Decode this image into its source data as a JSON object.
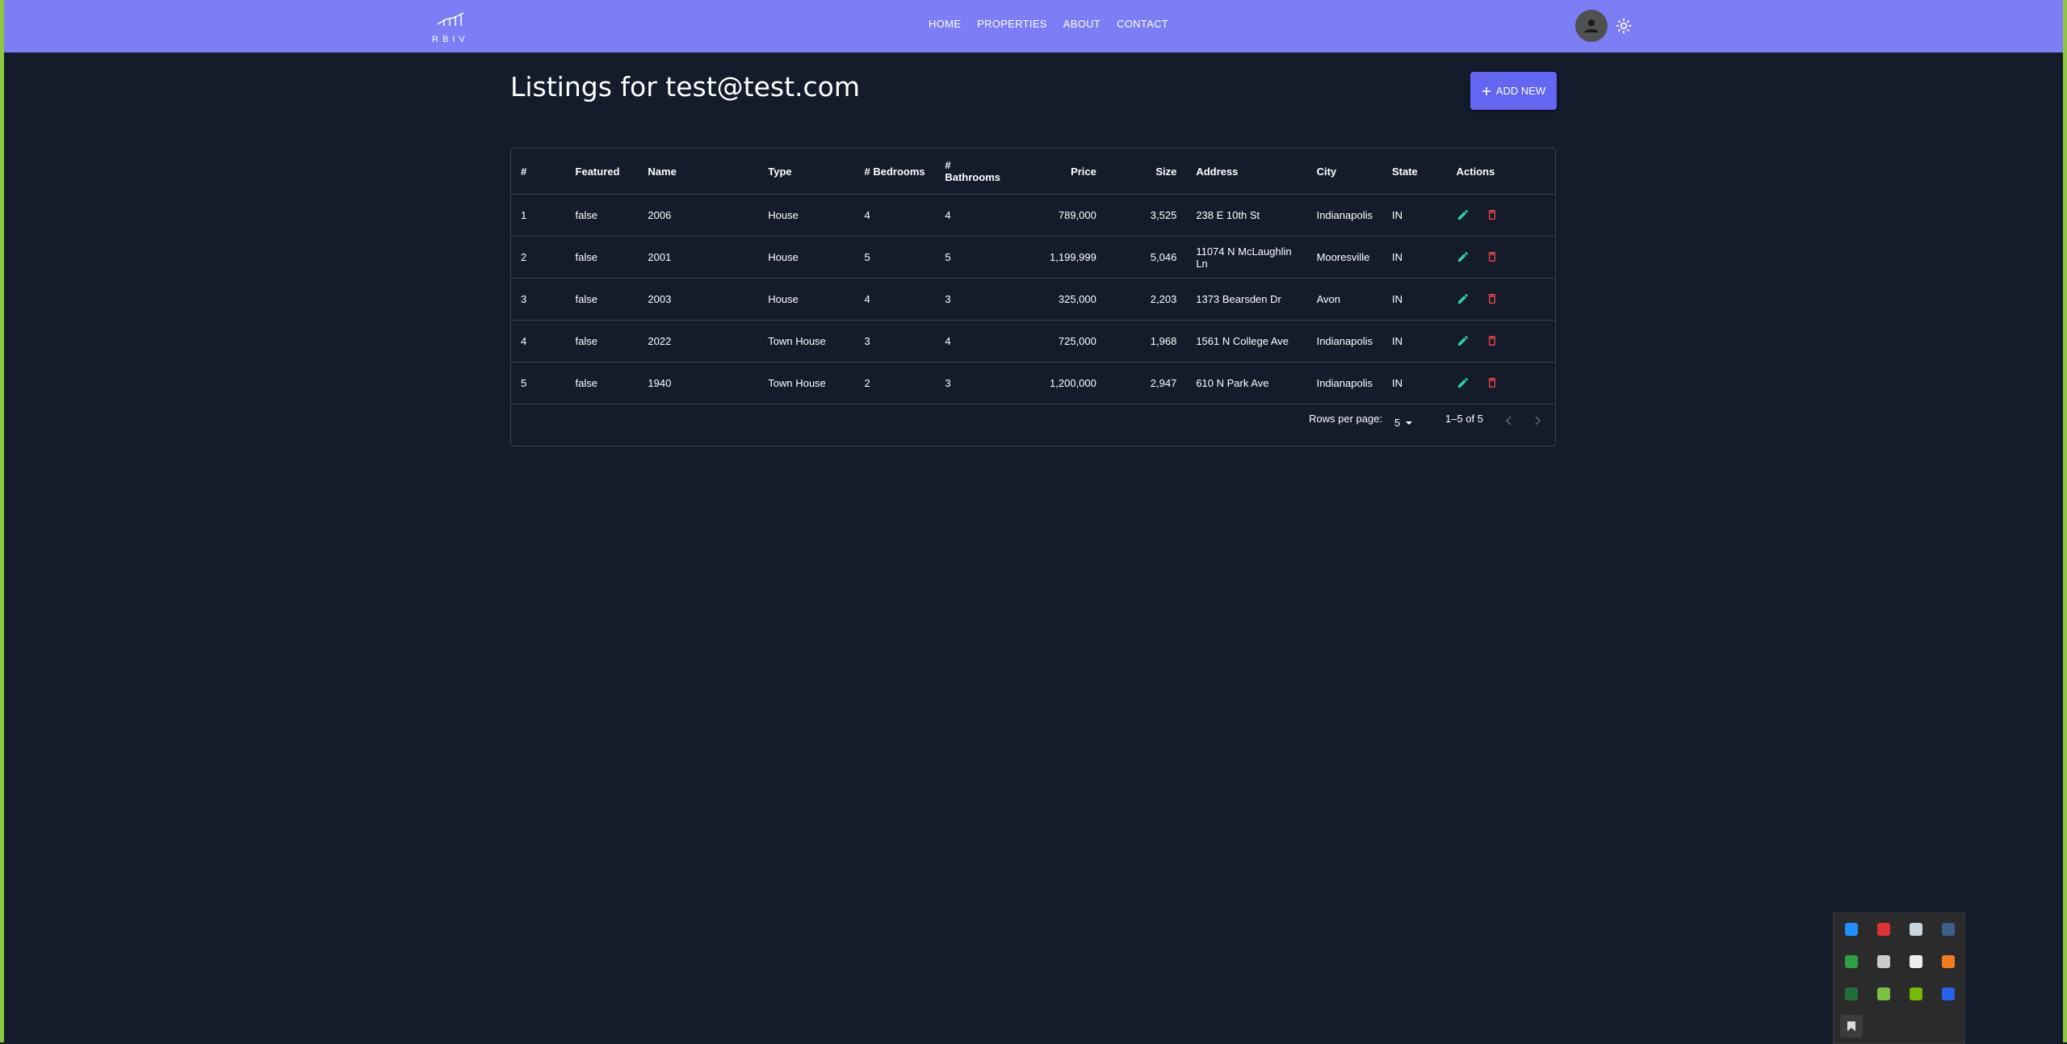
{
  "navbar": {
    "logo_text": "RBIV",
    "links": [
      "HOME",
      "PROPERTIES",
      "ABOUT",
      "CONTACT"
    ]
  },
  "page": {
    "title": "Listings for test@test.com",
    "add_button_label": "ADD NEW"
  },
  "table": {
    "headers": {
      "index": "#",
      "featured": "Featured",
      "name": "Name",
      "type": "Type",
      "bedrooms": "# Bedrooms",
      "bathrooms": "# Bathrooms",
      "price": "Price",
      "size": "Size",
      "address": "Address",
      "city": "City",
      "state": "State",
      "actions": "Actions"
    },
    "rows": [
      {
        "index": "1",
        "featured": "false",
        "name": "2006",
        "type": "House",
        "bedrooms": "4",
        "bathrooms": "4",
        "price": "789,000",
        "size": "3,525",
        "address": "238 E 10th St",
        "city": "Indianapolis",
        "state": "IN"
      },
      {
        "index": "2",
        "featured": "false",
        "name": "2001",
        "type": "House",
        "bedrooms": "5",
        "bathrooms": "5",
        "price": "1,199,999",
        "size": "5,046",
        "address": "11074 N McLaughlin Ln",
        "city": "Mooresville",
        "state": "IN"
      },
      {
        "index": "3",
        "featured": "false",
        "name": "2003",
        "type": "House",
        "bedrooms": "4",
        "bathrooms": "3",
        "price": "325,000",
        "size": "2,203",
        "address": "1373 Bearsden Dr",
        "city": "Avon",
        "state": "IN"
      },
      {
        "index": "4",
        "featured": "false",
        "name": "2022",
        "type": "Town House",
        "bedrooms": "3",
        "bathrooms": "4",
        "price": "725,000",
        "size": "1,968",
        "address": "1561 N College Ave",
        "city": "Indianapolis",
        "state": "IN"
      },
      {
        "index": "5",
        "featured": "false",
        "name": "1940",
        "type": "Town House",
        "bedrooms": "2",
        "bathrooms": "3",
        "price": "1,200,000",
        "size": "2,947",
        "address": "610 N Park Ave",
        "city": "Indianapolis",
        "state": "IN"
      }
    ],
    "pagination": {
      "rows_per_page_label": "Rows per page:",
      "rows_per_page_value": "5",
      "range_text": "1–5 of 5"
    }
  },
  "colors": {
    "navbar": "#7b7ef5",
    "background": "#141b2b",
    "accent_button": "#6366f1",
    "edit_icon": "#2dd4a4",
    "delete_icon": "#ef4444",
    "window_border": "#8dc63f"
  },
  "tray_icons": [
    "bluetooth-icon",
    "shield-icon",
    "steam-icon",
    "circle-app-icon",
    "green-circle-icon",
    "copy-icon",
    "microphone-icon",
    "orange-app-icon",
    "green-ring-icon",
    "play-icon",
    "nvidia-icon",
    "z-app-icon",
    "bookmark-icon"
  ]
}
